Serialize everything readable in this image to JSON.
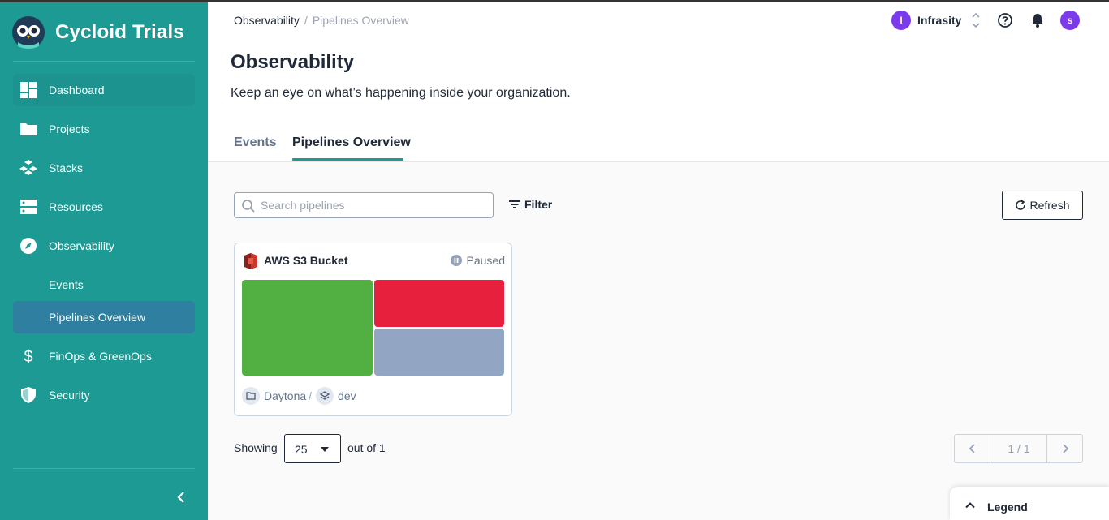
{
  "app": {
    "brand_name": "Cycloid Trials"
  },
  "sidebar": {
    "items": [
      {
        "label": "Dashboard",
        "icon": "dashboard-icon"
      },
      {
        "label": "Projects",
        "icon": "folder-icon"
      },
      {
        "label": "Stacks",
        "icon": "stacks-icon"
      },
      {
        "label": "Resources",
        "icon": "server-icon"
      },
      {
        "label": "Observability",
        "icon": "compass-icon"
      },
      {
        "label": "Events",
        "icon": ""
      },
      {
        "label": "Pipelines Overview",
        "icon": "",
        "active": true
      },
      {
        "label": "FinOps & GreenOps",
        "icon": "dollar-icon"
      },
      {
        "label": "Security",
        "icon": "shield-icon"
      }
    ]
  },
  "breadcrumb": {
    "root": "Observability",
    "separator": "/",
    "current": "Pipelines Overview"
  },
  "org": {
    "initial": "I",
    "name": "Infrasity"
  },
  "user": {
    "initial": "s"
  },
  "page": {
    "title": "Observability",
    "subtitle": "Keep an eye on what’s happening inside your organization."
  },
  "tabs": [
    {
      "label": "Events",
      "active": false
    },
    {
      "label": "Pipelines Overview",
      "active": true
    }
  ],
  "toolbar": {
    "search_placeholder": "Search pipelines",
    "search_value": "",
    "filter_label": "Filter",
    "refresh_label": "Refresh"
  },
  "pipelines": [
    {
      "name": "AWS S3 Bucket",
      "status": "Paused",
      "project": "Daytona",
      "environment": "dev",
      "blocks": [
        {
          "color": "#52b043"
        },
        {
          "color": "#e6203d"
        },
        {
          "color": "#92a5c3"
        }
      ]
    }
  ],
  "pagination": {
    "showing_label": "Showing",
    "per_page": "25",
    "out_of_label": "out of 1",
    "page_label": "1 / 1"
  },
  "legend": {
    "label": "Legend"
  },
  "colors": {
    "sidebar_bg": "#1e9a94",
    "sidebar_active": "#2e7fa0",
    "accent": "#1e9a94",
    "avatar": "#7c3aed"
  }
}
